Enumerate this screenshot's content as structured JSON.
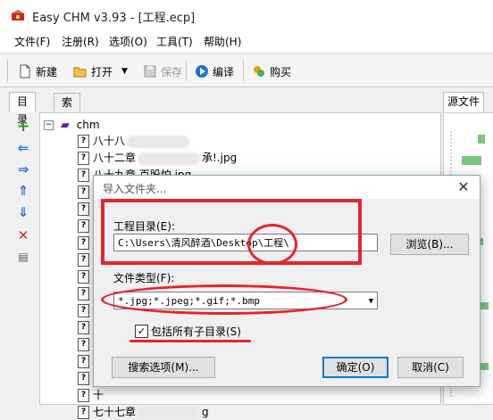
{
  "window": {
    "title": "Easy CHM v3.93 - [工程.ecp]"
  },
  "menu": [
    {
      "label": "文件(F)",
      "name": "menu-file"
    },
    {
      "label": "注册(R)",
      "name": "menu-register"
    },
    {
      "label": "选项(O)",
      "name": "menu-options"
    },
    {
      "label": "工具(T)",
      "name": "menu-tools"
    },
    {
      "label": "帮助(H)",
      "name": "menu-help"
    }
  ],
  "toolbar": {
    "new": "新建",
    "open": "打开",
    "save": "保存",
    "compile": "编译",
    "buy": "购买"
  },
  "left_tabs": [
    "目录",
    "索引"
  ],
  "right_tabs": {
    "source": "源文件"
  },
  "tree": {
    "root": "chm",
    "items": [
      {
        "text": "八十八"
      },
      {
        "text": "八十二章",
        "suffix": "承!.jpg"
      },
      {
        "text": "八十九章 百股",
        "suffix": "怕.jpg"
      },
      {
        "text": "八"
      },
      {
        "text": "八"
      },
      {
        "text": "八"
      },
      {
        "text": "八"
      },
      {
        "text": "八"
      },
      {
        "text": "八"
      },
      {
        "text": "八"
      },
      {
        "text": "九"
      },
      {
        "text": "十"
      },
      {
        "text": "十"
      },
      {
        "text": "十"
      },
      {
        "text": "十"
      },
      {
        "text": "十"
      },
      {
        "text": "七十七章",
        "suffix": "g"
      }
    ]
  },
  "dialog": {
    "title": "导入文件夹...",
    "dir_label": "工程目录(E):",
    "dir_value": "C:\\Users\\清风醉酒\\Desktop\\工程\\",
    "browse": "浏览(B)...",
    "type_label": "文件类型(F):",
    "type_value": "*.jpg;*.jpeg;*.gif;*.bmp",
    "include_sub": "包括所有子目录(S)",
    "include_checked": "✓",
    "search_opts": "搜索选项(M)...",
    "ok": "确定(O)",
    "cancel": "取消(C)"
  },
  "colors": {
    "accent": "#0078d7",
    "annotation": "#e8232f"
  }
}
